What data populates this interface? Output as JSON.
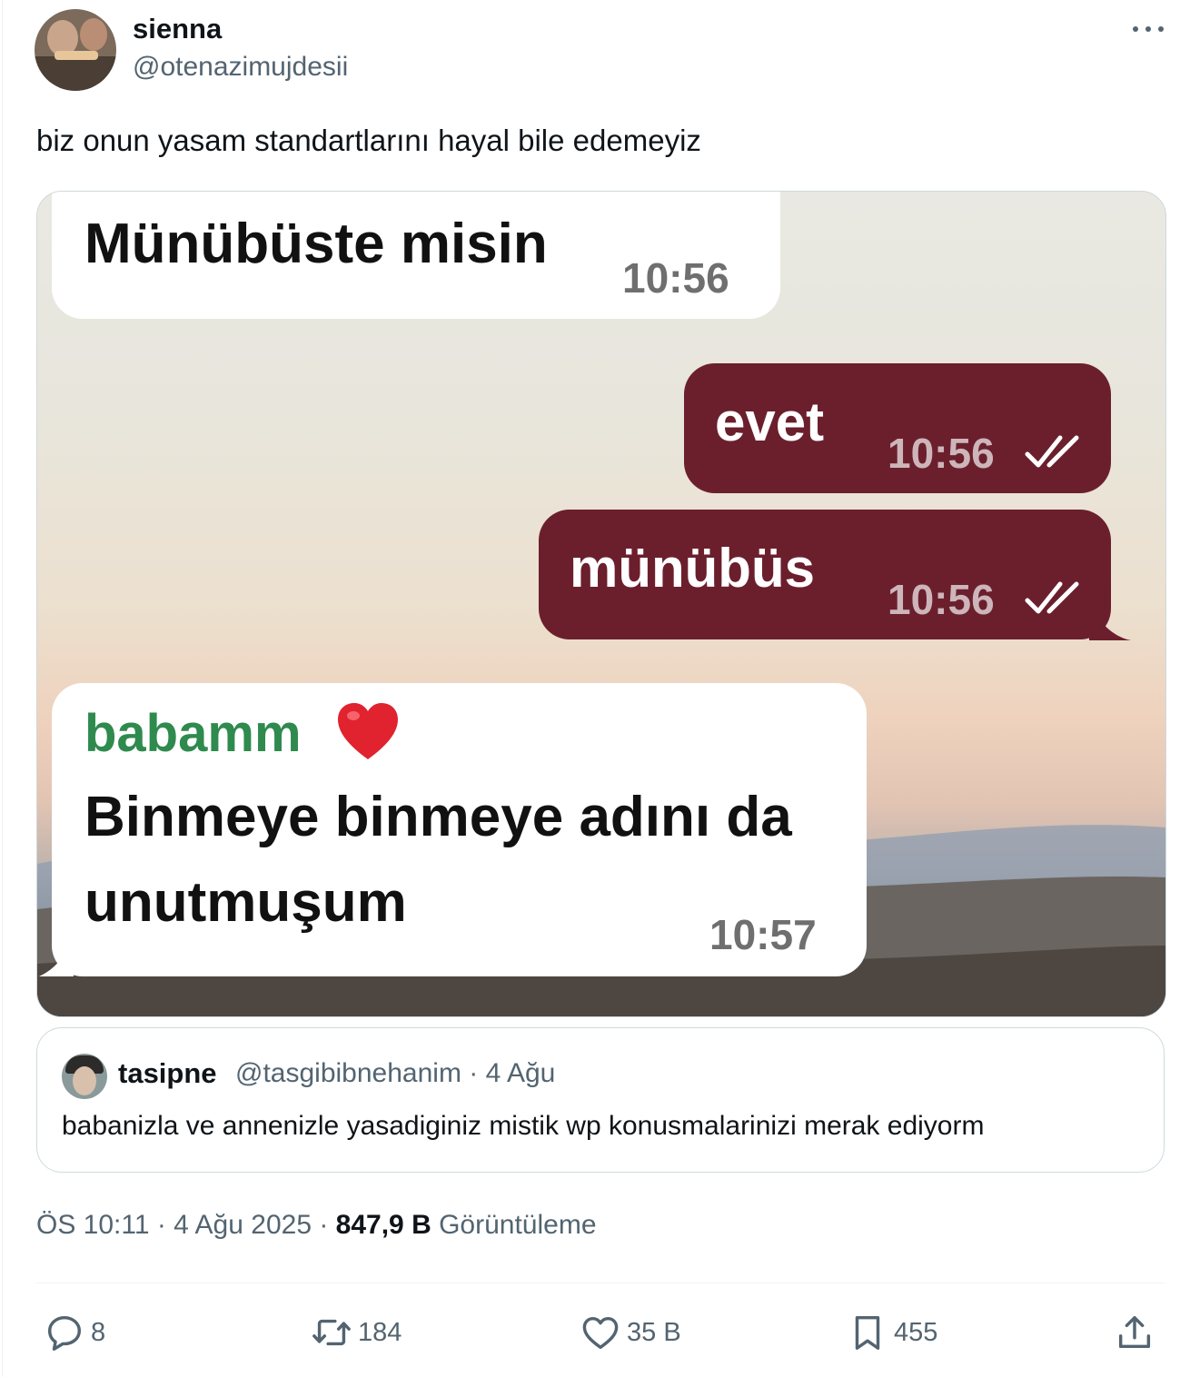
{
  "author": {
    "display_name": "sienna",
    "handle": "@otenazimujdesii"
  },
  "tweet": {
    "text": "biz onun yasam standartlarını hayal bile edemeyiz"
  },
  "media": {
    "messages": [
      {
        "direction": "incoming",
        "text": "Münübüste misin",
        "time": "10:56"
      },
      {
        "direction": "outgoing",
        "text": "evet",
        "time": "10:56",
        "status_icon": "double-check-icon"
      },
      {
        "direction": "outgoing",
        "text": "münübüs",
        "time": "10:56",
        "status_icon": "double-check-icon"
      },
      {
        "direction": "incoming",
        "sender": "babamm",
        "sender_icon": "red-heart-icon",
        "text_line1": "Binmeye binmeye adını da",
        "text_line2": "unutmuşum",
        "time": "10:57"
      }
    ],
    "colors": {
      "outgoing_bubble": "#6b1f2d",
      "incoming_bubble": "#ffffff",
      "sender_name": "#2f8a4e"
    }
  },
  "quoted": {
    "display_name": "tasipne",
    "meta": "@tasgibibnehanim · 4 Ağu",
    "text": "babanizla ve annenizle yasadiginiz mistik wp konusmalarinizi merak ediyorm"
  },
  "meta": {
    "time_date": "ÖS 10:11 · 4 Ağu 2025 · ",
    "views_count": "847,9 B",
    "views_label": " Görüntüleme"
  },
  "actions": {
    "replies": "8",
    "reposts": "184",
    "likes": "35 B",
    "bookmarks": "455"
  }
}
